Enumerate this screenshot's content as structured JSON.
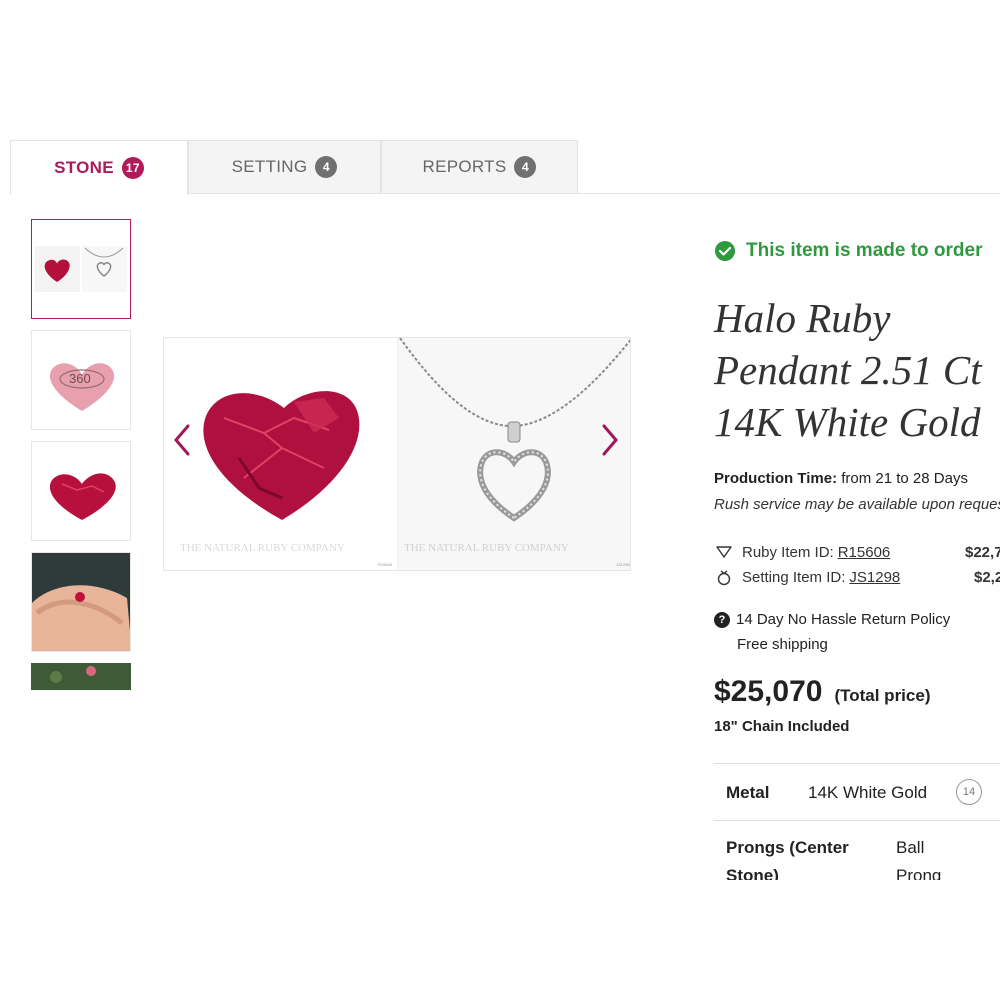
{
  "tabs": [
    {
      "label": "STONE",
      "count": "17"
    },
    {
      "label": "SETTING",
      "count": "4"
    },
    {
      "label": "REPORTS",
      "count": "4"
    }
  ],
  "gallery": {
    "thumb_360_label": "360",
    "watermark": "THE NATURAL RUBY COMPANY",
    "img_code_left": "R15606",
    "img_code_right": "JS1298"
  },
  "product": {
    "availability": "This item is made to order",
    "title_lines": [
      "Halo Ruby",
      "Pendant 2.51 Ct",
      "14K White Gold"
    ],
    "production_label": "Production Time:",
    "production_value": "from 21 to 28 Days",
    "rush_note": "Rush service may be available upon request",
    "ruby_item_label": "Ruby Item ID:",
    "ruby_item_id": "R15606",
    "ruby_item_price": "$22,7",
    "setting_item_label": "Setting Item ID:",
    "setting_item_id": "JS1298",
    "setting_item_price": "$2,2",
    "return_policy": "14 Day No Hassle Return Policy",
    "shipping": "Free shipping",
    "total_price": "$25,070",
    "total_label": "(Total price)",
    "chain_note": "18\" Chain Included"
  },
  "specs": {
    "metal_label": "Metal",
    "metal_value": "14K White Gold",
    "metal_badge": "14",
    "prongs_label_line1": "Prongs (Center",
    "prongs_label_line2": "Stone)",
    "prongs_value_line1": "Ball",
    "prongs_value_line2": "Prong"
  },
  "colors": {
    "accent": "#b0195a",
    "in_stock": "#2e9a3e",
    "ruby": "#c0103d"
  },
  "icons": [
    "check-circle-icon",
    "diamond-icon",
    "ring-icon",
    "question-icon",
    "chevron-left-icon",
    "chevron-right-icon"
  ]
}
